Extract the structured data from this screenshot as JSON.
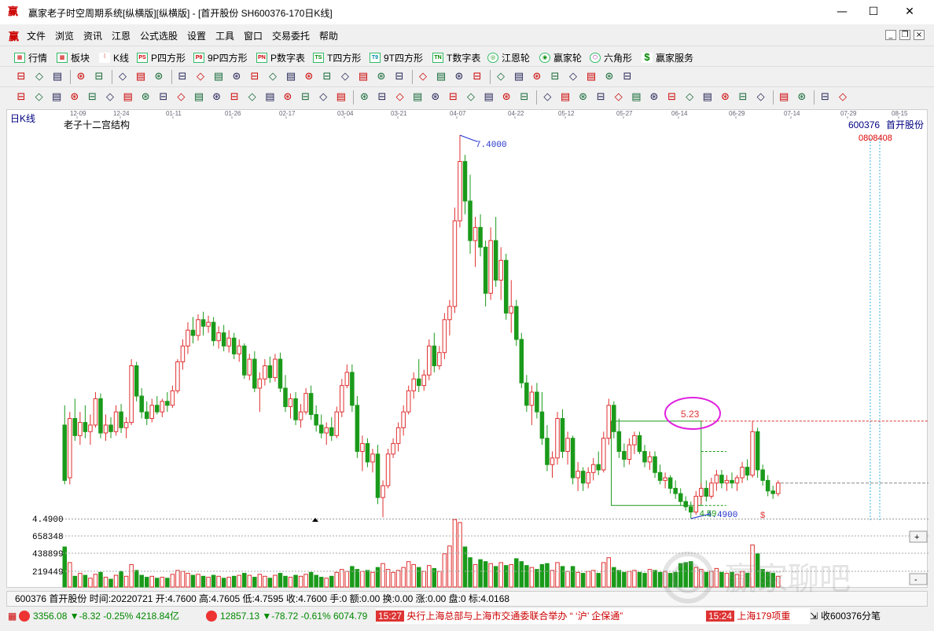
{
  "window": {
    "title": "赢家老子时空周期系统[纵横版][纵横版] - [首开股份   SH600376-170日K线]",
    "logo": "赢",
    "min": "—",
    "max": "☐",
    "close": "✕"
  },
  "menu": {
    "logo": "赢",
    "items": [
      "文件",
      "浏览",
      "资讯",
      "江恩",
      "公式选股",
      "设置",
      "工具",
      "窗口",
      "交易委托",
      "帮助"
    ]
  },
  "funcbar": {
    "items": [
      "行情",
      "板块",
      "K线",
      "P四方形",
      "9P四方形",
      "P数字表",
      "T四方形",
      "9T四方形",
      "T数字表",
      "江恩轮",
      "赢家轮",
      "六角形",
      "赢家服务"
    ]
  },
  "chart": {
    "period_label": "日K线",
    "indicator_title": "老子十二宫结构",
    "code": "600376",
    "name": "首开股份",
    "right_red_label": "0808408",
    "date_ticks": [
      "12-09",
      "12-24",
      "01-11",
      "01-26",
      "02-17",
      "03-04",
      "03-21",
      "04-07",
      "04-22",
      "05-12",
      "05-27",
      "06-14",
      "06-29",
      "07-14",
      "07-29",
      "08-15"
    ],
    "high_label": "7.4000",
    "low_label": "4.4900",
    "low_axis_label": "4.4900",
    "box_high_label": "5.23",
    "box_low_label": "4.59",
    "dollar_mark": "$",
    "volume_ticks": [
      "658348",
      "438899",
      "219449"
    ]
  },
  "chart_data": {
    "type": "candlestick",
    "title": "老子十二宫结构",
    "security": "600376 首开股份",
    "period": "日K线",
    "price_high": 7.4,
    "price_low": 4.49,
    "x_ticks": [
      "12-09",
      "12-24",
      "01-11",
      "01-26",
      "02-17",
      "03-04",
      "03-21",
      "04-07",
      "04-22",
      "05-12",
      "05-27",
      "06-14",
      "06-29",
      "07-14",
      "07-29",
      "08-15"
    ],
    "volume_ticks": [
      658348,
      438899,
      219449
    ],
    "candles": [
      [
        5.2,
        5.35,
        4.75,
        4.78
      ],
      [
        4.8,
        5.3,
        4.75,
        5.25
      ],
      [
        5.25,
        5.4,
        5.08,
        5.12
      ],
      [
        5.12,
        5.3,
        5.05,
        5.22
      ],
      [
        5.22,
        5.35,
        5.1,
        5.15
      ],
      [
        5.15,
        5.28,
        5.05,
        5.2
      ],
      [
        5.2,
        5.45,
        5.18,
        5.4
      ],
      [
        5.4,
        5.44,
        5.1,
        5.14
      ],
      [
        5.14,
        5.28,
        5.08,
        5.2
      ],
      [
        5.2,
        5.26,
        5.1,
        5.15
      ],
      [
        5.15,
        5.35,
        5.12,
        5.3
      ],
      [
        5.3,
        5.36,
        5.14,
        5.18
      ],
      [
        5.18,
        5.26,
        5.1,
        5.22
      ],
      [
        5.22,
        5.7,
        5.2,
        5.65
      ],
      [
        5.65,
        5.68,
        5.38,
        5.42
      ],
      [
        5.42,
        5.48,
        5.25,
        5.3
      ],
      [
        5.3,
        5.38,
        5.2,
        5.25
      ],
      [
        5.25,
        5.4,
        5.22,
        5.35
      ],
      [
        5.35,
        5.42,
        5.28,
        5.3
      ],
      [
        5.3,
        5.4,
        5.26,
        5.38
      ],
      [
        5.38,
        5.45,
        5.3,
        5.35
      ],
      [
        5.35,
        5.5,
        5.33,
        5.46
      ],
      [
        5.46,
        5.7,
        5.44,
        5.68
      ],
      [
        5.68,
        5.85,
        5.62,
        5.8
      ],
      [
        5.8,
        5.98,
        5.74,
        5.92
      ],
      [
        5.92,
        6.02,
        5.82,
        5.88
      ],
      [
        5.88,
        6.04,
        5.84,
        6.0
      ],
      [
        6.0,
        6.06,
        5.88,
        5.95
      ],
      [
        5.95,
        6.03,
        5.9,
        5.98
      ],
      [
        5.98,
        6.02,
        5.8,
        5.84
      ],
      [
        5.84,
        5.95,
        5.78,
        5.9
      ],
      [
        5.9,
        5.96,
        5.76,
        5.8
      ],
      [
        5.8,
        5.92,
        5.75,
        5.86
      ],
      [
        5.86,
        5.9,
        5.7,
        5.74
      ],
      [
        5.74,
        5.85,
        5.68,
        5.8
      ],
      [
        5.8,
        5.82,
        5.55,
        5.58
      ],
      [
        5.58,
        5.74,
        5.54,
        5.7
      ],
      [
        5.7,
        5.76,
        5.45,
        5.48
      ],
      [
        5.48,
        5.6,
        5.3,
        5.55
      ],
      [
        5.55,
        5.7,
        5.5,
        5.65
      ],
      [
        5.65,
        5.72,
        5.52,
        5.56
      ],
      [
        5.56,
        5.74,
        5.53,
        5.7
      ],
      [
        5.7,
        5.75,
        5.45,
        5.48
      ],
      [
        5.48,
        5.58,
        5.3,
        5.34
      ],
      [
        5.34,
        5.44,
        5.25,
        5.4
      ],
      [
        5.4,
        5.45,
        5.2,
        5.24
      ],
      [
        5.24,
        5.36,
        5.18,
        5.3
      ],
      [
        5.3,
        5.48,
        5.28,
        5.44
      ],
      [
        5.44,
        5.5,
        5.24,
        5.28
      ],
      [
        5.28,
        5.35,
        5.15,
        5.2
      ],
      [
        5.2,
        5.28,
        5.1,
        5.14
      ],
      [
        5.14,
        5.22,
        5.05,
        5.18
      ],
      [
        5.18,
        5.26,
        5.08,
        5.12
      ],
      [
        5.12,
        5.34,
        5.1,
        5.3
      ],
      [
        5.3,
        5.55,
        5.26,
        5.5
      ],
      [
        5.5,
        5.66,
        5.48,
        5.6
      ],
      [
        5.6,
        5.66,
        5.3,
        5.35
      ],
      [
        5.35,
        5.42,
        4.95,
        5.0
      ],
      [
        5.0,
        5.12,
        4.85,
        5.06
      ],
      [
        5.06,
        5.1,
        4.88,
        4.92
      ],
      [
        4.92,
        5.02,
        4.84,
        4.98
      ],
      [
        4.98,
        5.05,
        4.6,
        4.65
      ],
      [
        4.65,
        4.78,
        4.5,
        4.74
      ],
      [
        4.74,
        5.02,
        4.72,
        4.98
      ],
      [
        4.98,
        5.1,
        4.95,
        5.06
      ],
      [
        5.06,
        5.22,
        5.0,
        5.18
      ],
      [
        5.18,
        5.35,
        5.12,
        5.3
      ],
      [
        5.3,
        5.5,
        5.28,
        5.46
      ],
      [
        5.46,
        5.6,
        5.4,
        5.55
      ],
      [
        5.55,
        5.7,
        5.45,
        5.5
      ],
      [
        5.5,
        5.62,
        5.46,
        5.58
      ],
      [
        5.58,
        5.85,
        5.54,
        5.8
      ],
      [
        5.8,
        5.9,
        5.6,
        5.65
      ],
      [
        5.65,
        5.8,
        5.62,
        5.75
      ],
      [
        5.75,
        6.05,
        5.7,
        6.0
      ],
      [
        6.0,
        6.15,
        5.88,
        6.1
      ],
      [
        6.1,
        6.85,
        6.05,
        6.75
      ],
      [
        6.75,
        7.4,
        6.7,
        7.2
      ],
      [
        7.2,
        7.25,
        6.8,
        6.9
      ],
      [
        6.9,
        7.1,
        6.5,
        6.6
      ],
      [
        6.6,
        6.78,
        6.4,
        6.7
      ],
      [
        6.7,
        6.8,
        6.48,
        6.55
      ],
      [
        6.55,
        6.6,
        6.1,
        6.2
      ],
      [
        6.2,
        6.7,
        6.15,
        6.6
      ],
      [
        6.6,
        6.78,
        6.25,
        6.3
      ],
      [
        6.3,
        6.55,
        6.15,
        6.45
      ],
      [
        6.45,
        6.5,
        6.0,
        6.05
      ],
      [
        6.05,
        6.3,
        5.9,
        6.1
      ],
      [
        6.1,
        6.15,
        5.8,
        5.85
      ],
      [
        5.85,
        5.9,
        5.48,
        5.52
      ],
      [
        5.52,
        5.58,
        5.3,
        5.35
      ],
      [
        5.35,
        5.5,
        5.2,
        5.45
      ],
      [
        5.45,
        5.52,
        5.25,
        5.3
      ],
      [
        5.3,
        5.45,
        5.05,
        5.1
      ],
      [
        5.1,
        5.2,
        4.85,
        4.9
      ],
      [
        4.9,
        5.0,
        4.8,
        4.95
      ],
      [
        4.95,
        5.3,
        4.9,
        5.25
      ],
      [
        5.25,
        5.32,
        4.95,
        5.0
      ],
      [
        5.0,
        5.15,
        4.9,
        5.1
      ],
      [
        5.1,
        5.12,
        4.75,
        4.8
      ],
      [
        4.8,
        4.92,
        4.7,
        4.85
      ],
      [
        4.85,
        4.88,
        4.7,
        4.76
      ],
      [
        4.76,
        4.88,
        4.72,
        4.84
      ],
      [
        4.84,
        4.95,
        4.78,
        4.9
      ],
      [
        4.9,
        5.0,
        4.82,
        4.86
      ],
      [
        4.86,
        5.15,
        4.84,
        5.1
      ],
      [
        5.1,
        5.4,
        5.05,
        5.35
      ],
      [
        5.35,
        5.38,
        5.1,
        5.15
      ],
      [
        5.15,
        5.25,
        4.95,
        5.0
      ],
      [
        5.0,
        5.06,
        4.88,
        4.94
      ],
      [
        4.94,
        5.1,
        4.9,
        5.05
      ],
      [
        5.05,
        5.15,
        4.98,
        5.12
      ],
      [
        5.12,
        5.15,
        4.98,
        5.0
      ],
      [
        5.0,
        5.05,
        4.88,
        4.92
      ],
      [
        4.92,
        5.0,
        4.86,
        4.96
      ],
      [
        4.96,
        5.0,
        4.8,
        4.84
      ],
      [
        4.84,
        4.9,
        4.75,
        4.78
      ],
      [
        4.78,
        4.84,
        4.72,
        4.8
      ],
      [
        4.8,
        4.82,
        4.68,
        4.72
      ],
      [
        4.72,
        4.78,
        4.64,
        4.68
      ],
      [
        4.68,
        4.72,
        4.59,
        4.62
      ],
      [
        4.62,
        4.66,
        4.55,
        4.58
      ],
      [
        4.58,
        4.62,
        4.49,
        4.54
      ],
      [
        4.54,
        4.7,
        4.52,
        4.66
      ],
      [
        4.66,
        4.76,
        4.6,
        4.72
      ],
      [
        4.72,
        4.78,
        4.62,
        4.66
      ],
      [
        4.66,
        4.8,
        4.64,
        4.76
      ],
      [
        4.76,
        4.86,
        4.7,
        4.82
      ],
      [
        4.82,
        4.86,
        4.72,
        4.76
      ],
      [
        4.76,
        4.82,
        4.7,
        4.78
      ],
      [
        4.78,
        4.84,
        4.72,
        4.76
      ],
      [
        4.76,
        4.82,
        4.7,
        4.8
      ],
      [
        4.8,
        4.92,
        4.76,
        4.88
      ],
      [
        4.88,
        4.94,
        4.78,
        4.82
      ],
      [
        4.82,
        5.23,
        4.8,
        5.15
      ],
      [
        5.15,
        5.18,
        4.8,
        4.86
      ],
      [
        4.86,
        4.9,
        4.74,
        4.78
      ],
      [
        4.78,
        4.82,
        4.66,
        4.7
      ],
      [
        4.7,
        4.74,
        4.64,
        4.68
      ],
      [
        4.68,
        4.78,
        4.66,
        4.76
      ]
    ],
    "volumes": [
      410,
      250,
      110,
      140,
      120,
      90,
      130,
      150,
      100,
      80,
      120,
      160,
      110,
      230,
      170,
      120,
      100,
      110,
      90,
      100,
      90,
      130,
      170,
      160,
      140,
      120,
      130,
      110,
      100,
      120,
      110,
      90,
      100,
      110,
      120,
      140,
      120,
      100,
      130,
      110,
      90,
      120,
      140,
      110,
      100,
      120,
      110,
      130,
      150,
      120,
      100,
      90,
      110,
      150,
      180,
      160,
      210,
      180,
      160,
      170,
      150,
      200,
      240,
      180,
      150,
      170,
      200,
      260,
      230,
      200,
      160,
      220,
      190,
      160,
      340,
      420,
      690,
      660,
      410,
      300,
      230,
      280,
      260,
      240,
      210,
      250,
      220,
      230,
      290,
      260,
      220,
      200,
      180,
      230,
      240,
      170,
      250,
      210,
      160,
      210,
      150,
      140,
      160,
      170,
      140,
      250,
      300,
      200,
      170,
      150,
      160,
      170,
      150,
      140,
      180,
      170,
      150,
      160,
      140,
      150,
      240,
      250,
      260,
      200,
      180,
      150,
      160,
      190,
      150,
      140,
      150,
      130,
      160,
      140,
      430,
      340,
      180,
      150,
      140,
      110
    ]
  },
  "status": {
    "line": "600376 首开股份 时间:20220721 开:4.7600 高:4.7605 低:4.7595 收:4.7600 手:0 额:0.00 换:0.00 涨:0.00 盘:0 标:4.0168"
  },
  "taskbar": {
    "index1": "3356.08 ▼-8.32 -0.25% 4218.84亿",
    "index2": "12857.13 ▼-78.72 -0.61% 6074.79",
    "news1_time": "15:27",
    "news1_text": "央行上海总部与上海市交通委联合举办 “ ‘沪’ 企保通”",
    "news2_time": "15:24",
    "news2_text": "上海179项重",
    "right": "收600376分笔"
  },
  "watermark": "赢家聊吧",
  "colors": {
    "up": "#e03030",
    "down": "#1a9a1a",
    "axis_text": "#000080",
    "box": "#1a9a1a",
    "circle": "#e020e0"
  }
}
